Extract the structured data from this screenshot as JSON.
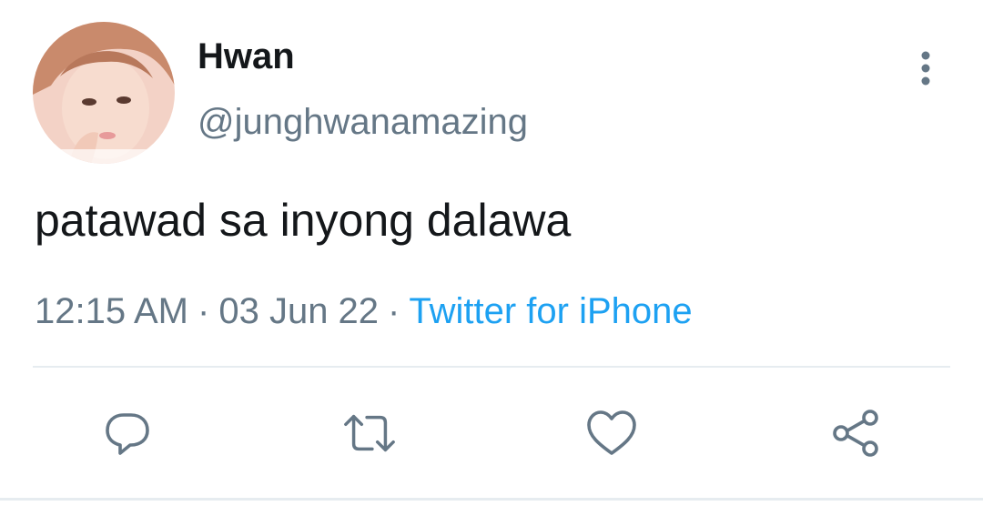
{
  "tweet": {
    "author": {
      "display_name": "Hwan",
      "handle": "@junghwanamazing",
      "avatar": "profile-photo"
    },
    "text": "patawad sa inyong dalawa",
    "time": "12:15 AM",
    "date": "03 Jun 22",
    "separator": "·",
    "client": "Twitter for iPhone"
  },
  "actions": {
    "reply": "reply-icon",
    "retweet": "retweet-icon",
    "like": "heart-icon",
    "share": "share-icon",
    "more": "more-vertical-icon"
  },
  "colors": {
    "text_primary": "#14171a",
    "text_secondary": "#657786",
    "link": "#1da1f2",
    "divider": "#e6ecf0"
  }
}
